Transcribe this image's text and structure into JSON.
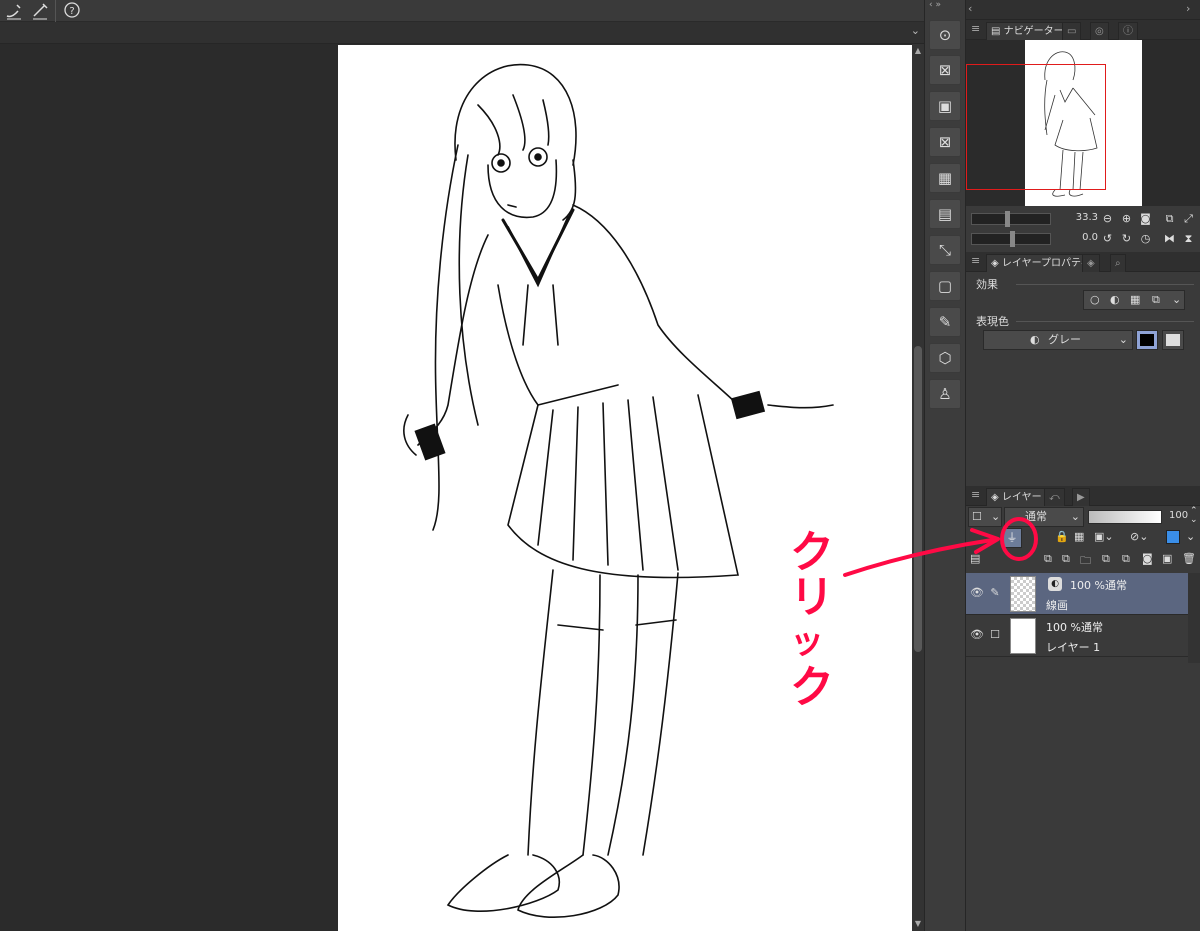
{
  "toolbar": {
    "icons": [
      "pen-curve-icon",
      "pen-line-icon",
      "help-icon"
    ]
  },
  "command_bar": {
    "icons": [
      "cursor-icon",
      "close-file-icon",
      "save-icon",
      "delete-icon",
      "checker-icon",
      "template-icon",
      "crop-icon",
      "frame-icon",
      "edit-icon",
      "3d-object-icon",
      "figure-icon"
    ]
  },
  "navigator": {
    "tab_label": "ナビゲーター",
    "zoom_value": "33.3",
    "rotation_value": "0.0"
  },
  "layer_property": {
    "tab_label": "レイヤープロパティ",
    "effect_label": "効果",
    "color_label": "表現色",
    "color_value": "グレー"
  },
  "layers_panel": {
    "tab_label": "レイヤー",
    "blend_mode": "通常",
    "opacity": "100",
    "layers": [
      {
        "mode": "100 %通常",
        "name": "線画",
        "selected": true
      },
      {
        "mode": "100 %通常",
        "name": "レイヤー 1",
        "selected": false
      }
    ]
  },
  "annotation": {
    "text_chars": [
      "ク",
      "リ",
      "ッ",
      "ク"
    ],
    "color": "#ff0a45"
  }
}
